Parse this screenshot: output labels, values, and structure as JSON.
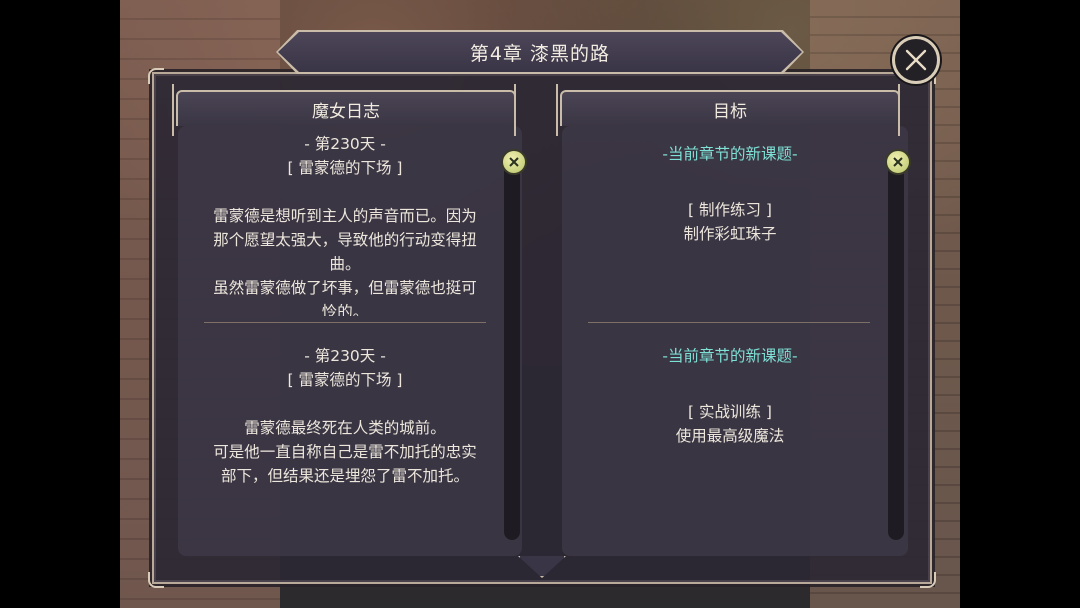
{
  "window": {
    "title": "第4章  漆黑的路"
  },
  "left_panel": {
    "header": "魔女日志",
    "entries": [
      {
        "day": "- 第230天 -",
        "subtitle": "[ 雷蒙德的下场 ]",
        "lines": [
          "雷蒙德是想听到主人的声音而已。因为",
          "那个愿望太强大，导致他的行动变得扭",
          "曲。",
          "虽然雷蒙德做了坏事，但雷蒙德也挺可",
          "怜的。"
        ]
      },
      {
        "day": "- 第230天 -",
        "subtitle": "[ 雷蒙德的下场 ]",
        "lines": [
          "雷蒙德最终死在人类的城前。",
          "可是他一直自称自己是雷不加托的忠实",
          "部下，但结果还是埋怨了雷不加托。"
        ]
      }
    ]
  },
  "right_panel": {
    "header": "目标",
    "goals": [
      {
        "heading": "-当前章节的新课题-",
        "category": "[ 制作练习 ]",
        "task": "制作彩虹珠子"
      },
      {
        "heading": "-当前章节的新课题-",
        "category": "[ 实战训练 ]",
        "task": "使用最高级魔法"
      }
    ]
  },
  "icons": {
    "close": "close-icon",
    "scroll_knob": "scroll-knob-icon"
  },
  "colors": {
    "accent_teal": "#7fe0d6",
    "frame_gold": "#c9bca8",
    "panel_bg": "#2c2834"
  }
}
